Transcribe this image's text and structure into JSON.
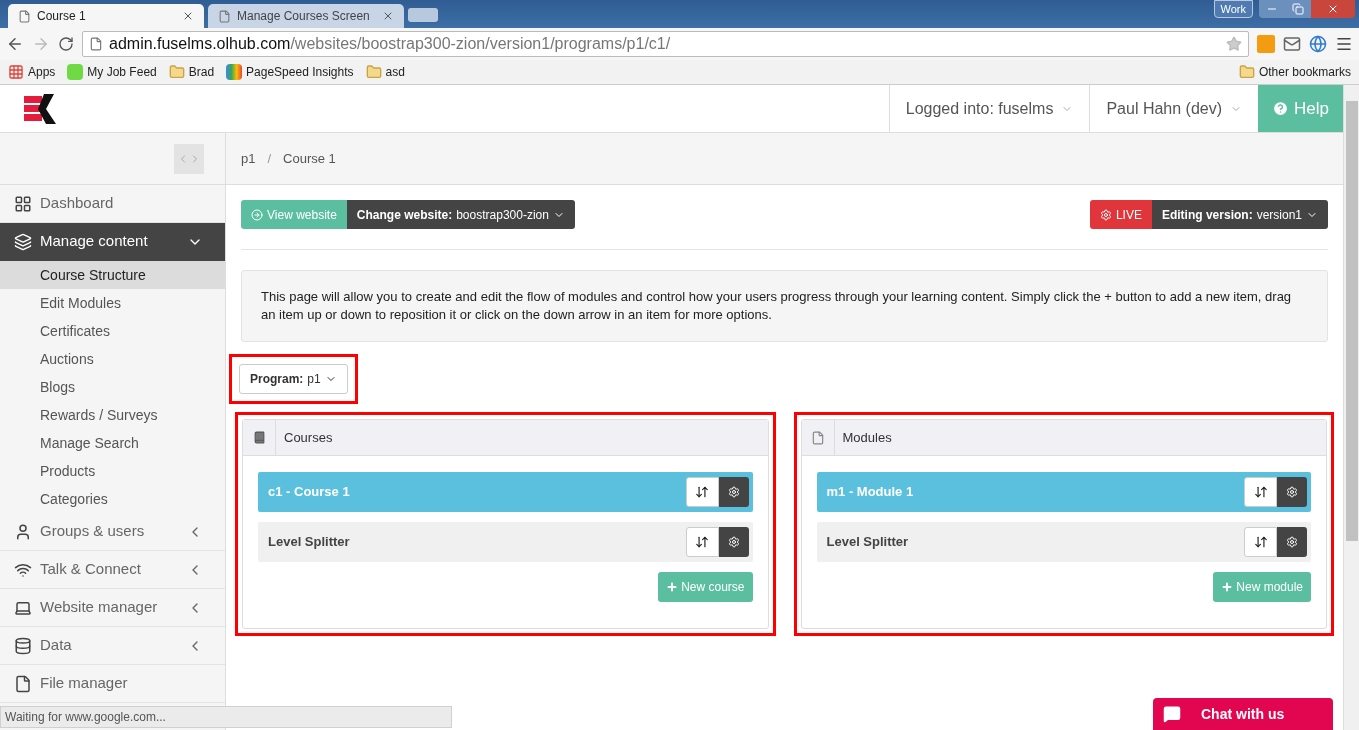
{
  "browser": {
    "tabs": [
      {
        "title": "Course 1",
        "selected": true
      },
      {
        "title": "Manage Courses Screen",
        "selected": false
      }
    ],
    "profile": "Work",
    "address": {
      "host": "admin.fuselms.olhub.com",
      "path": "/websites/boostrap300-zion/version1/programs/p1/c1/"
    },
    "bookmarks": [
      {
        "label": "Apps",
        "kind": "apps"
      },
      {
        "label": "My Job Feed",
        "kind": "upwork"
      },
      {
        "label": "Brad",
        "kind": "folder"
      },
      {
        "label": "PageSpeed Insights",
        "kind": "pagespeed"
      },
      {
        "label": "asd",
        "kind": "folder"
      }
    ],
    "other_bookmarks": "Other bookmarks",
    "status": "Waiting for www.google.com..."
  },
  "header": {
    "logged_into": "Logged into: fuselms",
    "user": "Paul Hahn (dev)",
    "help": "Help"
  },
  "sidebar": {
    "items": [
      {
        "label": "Dashboard",
        "kind": "link",
        "selected": false
      },
      {
        "label": "Manage content",
        "kind": "group",
        "selected": true,
        "expanded": true,
        "children": [
          {
            "label": "Course Structure",
            "selected": true
          },
          {
            "label": "Edit Modules",
            "selected": false
          },
          {
            "label": "Certificates",
            "selected": false
          },
          {
            "label": "Auctions",
            "selected": false
          },
          {
            "label": "Blogs",
            "selected": false
          },
          {
            "label": "Rewards / Surveys",
            "selected": false
          },
          {
            "label": "Manage Search",
            "selected": false
          },
          {
            "label": "Products",
            "selected": false
          },
          {
            "label": "Categories",
            "selected": false
          }
        ]
      },
      {
        "label": "Groups & users",
        "kind": "group",
        "selected": false,
        "expanded": false
      },
      {
        "label": "Talk & Connect",
        "kind": "group",
        "selected": false,
        "expanded": false
      },
      {
        "label": "Website manager",
        "kind": "group",
        "selected": false,
        "expanded": false
      },
      {
        "label": "Data",
        "kind": "group",
        "selected": false,
        "expanded": false
      },
      {
        "label": "File manager",
        "kind": "link",
        "selected": false
      }
    ]
  },
  "breadcrumb": {
    "separator": "/",
    "items": [
      "p1",
      "Course 1"
    ]
  },
  "toolbar": {
    "view_website": "View website",
    "change_website": {
      "label": "Change website:",
      "value": "boostrap300-zion"
    },
    "live": "LIVE",
    "editing": {
      "label": "Editing version:",
      "value": "version1"
    }
  },
  "info": "This page will allow you to create and edit the flow of modules and control how your users progress through your learning content. Simply click the + button to add a new item, drag an item up or down to reposition it or click on the down arrow in an item for more options.",
  "program": {
    "label": "Program:",
    "value": "p1"
  },
  "panels": [
    {
      "title": "Courses",
      "items": [
        {
          "label": "c1 - Course 1",
          "selected": true
        },
        {
          "label": "Level Splitter",
          "selected": false
        }
      ],
      "add_button": "New course"
    },
    {
      "title": "Modules",
      "items": [
        {
          "label": "m1 - Module 1",
          "selected": true
        },
        {
          "label": "Level Splitter",
          "selected": false
        }
      ],
      "add_button": "New module"
    }
  ],
  "chat": "Chat with us"
}
